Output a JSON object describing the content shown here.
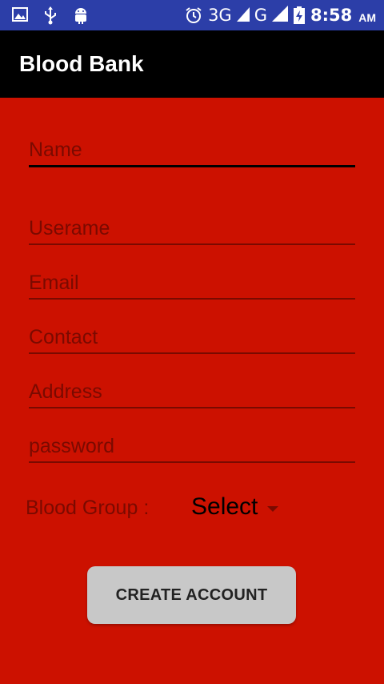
{
  "status_bar": {
    "icons_left": [
      "image-icon",
      "usb-icon",
      "android-icon"
    ],
    "icons_right": [
      "alarm-icon",
      "signal-icon",
      "battery-icon"
    ],
    "network_1": "3G",
    "network_2": "G",
    "time": "8:58",
    "ampm": "AM"
  },
  "app_bar": {
    "title": "Blood Bank",
    "background": "#000000"
  },
  "form": {
    "background": "#cc1100",
    "fields": {
      "name": {
        "placeholder": "Name",
        "value": ""
      },
      "username": {
        "placeholder": "Userame",
        "value": ""
      },
      "email": {
        "placeholder": "Email",
        "value": ""
      },
      "contact": {
        "placeholder": "Contact",
        "value": ""
      },
      "address": {
        "placeholder": "Address",
        "value": ""
      },
      "password": {
        "placeholder": "password",
        "value": ""
      }
    },
    "blood_group_label": "Blood Group :",
    "blood_group_selected": "Select",
    "create_button_label": "CREATE ACCOUNT"
  }
}
